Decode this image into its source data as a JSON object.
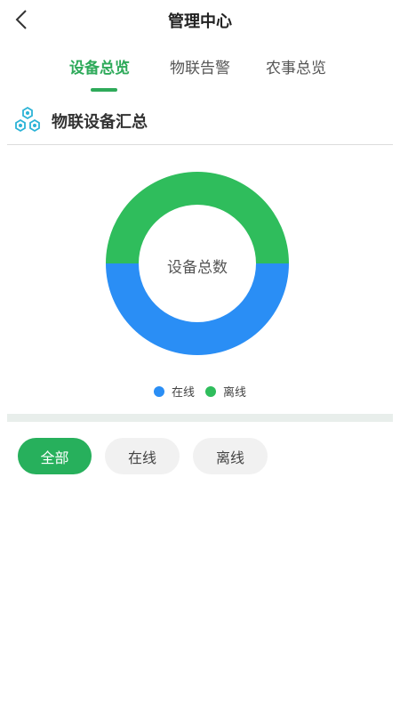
{
  "header": {
    "title": "管理中心",
    "back_icon": "chevron-left-icon"
  },
  "tabs": [
    {
      "label": "设备总览",
      "active": true
    },
    {
      "label": "物联告警",
      "active": false
    },
    {
      "label": "农事总览",
      "active": false
    }
  ],
  "section": {
    "title": "物联设备汇总",
    "icon": "hexagon-cluster-icon"
  },
  "chart_data": {
    "type": "pie",
    "center_label": "设备总数",
    "series": [
      {
        "name": "在线",
        "value": 1,
        "color": "#2a8ef5"
      },
      {
        "name": "离线",
        "value": 1,
        "color": "#2fbd5c"
      }
    ]
  },
  "filters": [
    {
      "label": "全部",
      "active": true
    },
    {
      "label": "在线",
      "active": false
    },
    {
      "label": "离线",
      "active": false
    }
  ],
  "colors": {
    "accent": "#2eaa5a",
    "online": "#2a8ef5",
    "offline": "#2fbd5c"
  }
}
